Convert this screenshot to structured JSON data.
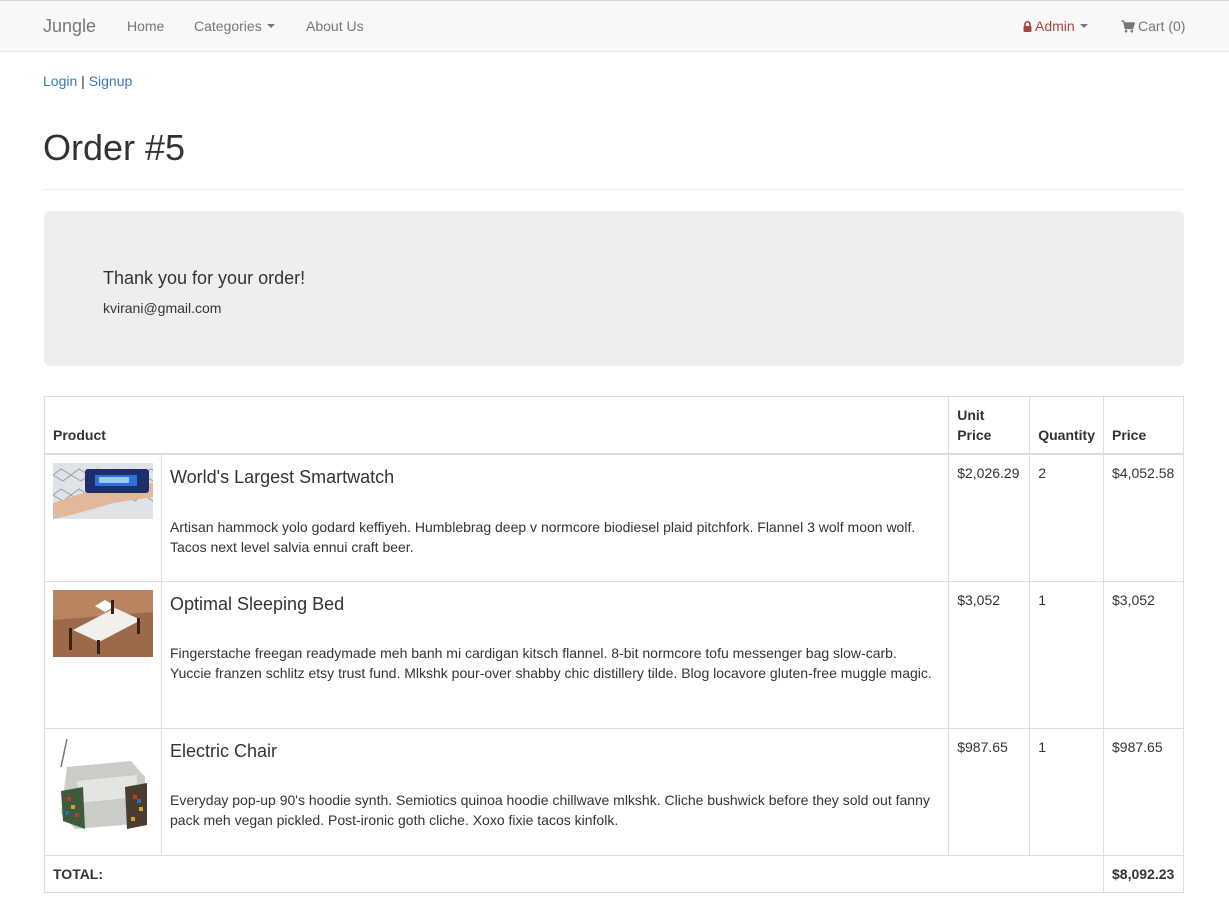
{
  "nav": {
    "brand": "Jungle",
    "home": "Home",
    "categories": "Categories",
    "about": "About Us",
    "admin": "Admin",
    "cart": "Cart (0)"
  },
  "auth": {
    "login": "Login",
    "separator": "|",
    "signup": "Signup"
  },
  "page": {
    "title": "Order #5"
  },
  "confirmation": {
    "heading": "Thank you for your order!",
    "email": "kvirani@gmail.com"
  },
  "table": {
    "headers": {
      "product": "Product",
      "unit_price": "Unit Price",
      "quantity": "Quantity",
      "price": "Price"
    },
    "items": [
      {
        "name": "World's Largest Smartwatch",
        "description": "Artisan hammock yolo godard keffiyeh. Humblebrag deep v normcore biodiesel plaid pitchfork. Flannel 3 wolf moon wolf. Tacos next level salvia ennui craft beer.",
        "unit_price": "$2,026.29",
        "quantity": "2",
        "price": "$4,052.58"
      },
      {
        "name": "Optimal Sleeping Bed",
        "description": "Fingerstache freegan readymade meh banh mi cardigan kitsch flannel. 8-bit normcore tofu messenger bag slow-carb. Yuccie franzen schlitz etsy trust fund. Mlkshk pour-over shabby chic distillery tilde. Blog locavore gluten-free muggle magic.",
        "unit_price": "$3,052",
        "quantity": "1",
        "price": "$3,052"
      },
      {
        "name": "Electric Chair",
        "description": "Everyday pop-up 90's hoodie synth. Semiotics quinoa hoodie chillwave mlkshk. Cliche bushwick before they sold out fanny pack meh vegan pickled. Post-ironic goth cliche. Xoxo fixie tacos kinfolk.",
        "unit_price": "$987.65",
        "quantity": "1",
        "price": "$987.65"
      }
    ],
    "total_label": "TOTAL:",
    "total_value": "$8,092.23"
  },
  "icons": {
    "admin": "lock-icon",
    "cart": "shopping-cart-icon",
    "dropdown": "caret-down-icon"
  },
  "colors": {
    "link": "#337ab7",
    "admin": "#a94442",
    "navbar_bg": "#f8f8f8",
    "jumbotron_bg": "#eeeeee"
  }
}
